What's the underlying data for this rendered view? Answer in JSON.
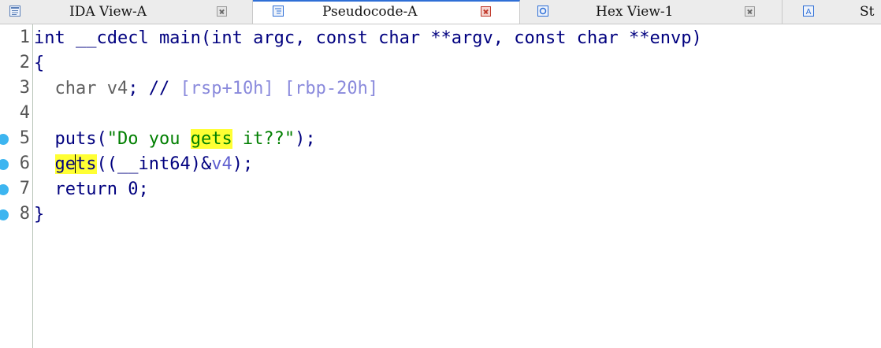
{
  "tabs": [
    {
      "label": "IDA View-A",
      "icon": "disassembly-view-icon",
      "active": false
    },
    {
      "label": "Pseudocode-A",
      "icon": "pseudocode-icon",
      "active": true
    },
    {
      "label": "Hex View-1",
      "icon": "hex-view-icon",
      "active": false
    },
    {
      "label": "St",
      "icon": "structures-icon",
      "active": false
    }
  ],
  "editor": {
    "highlight_color": "#ffff33",
    "breakpoint_color": "#3db5f0",
    "lines": [
      {
        "num": "1",
        "text_a": "int __cdecl main(int argc, const char **argv, const char **envp)"
      },
      {
        "num": "2",
        "text_a": "{"
      },
      {
        "num": "3",
        "text_a": "char",
        "text_b": "v4",
        "text_c": "; //",
        "text_d": "[rsp+10h] [rbp-20h]"
      },
      {
        "num": "4"
      },
      {
        "num": "5",
        "text_a": "puts(",
        "text_b": "\"Do you ",
        "text_c": "gets",
        "text_d": " it??\"",
        "text_e": ");"
      },
      {
        "num": "6",
        "text_a": "ge",
        "text_b": "ts",
        "text_c": "((__int64)&",
        "text_d": "v4",
        "text_e": ");"
      },
      {
        "num": "7",
        "text_a": "return 0;"
      },
      {
        "num": "8",
        "text_a": "}"
      }
    ],
    "breakpoint_lines": [
      "5",
      "6",
      "7",
      "8"
    ]
  }
}
